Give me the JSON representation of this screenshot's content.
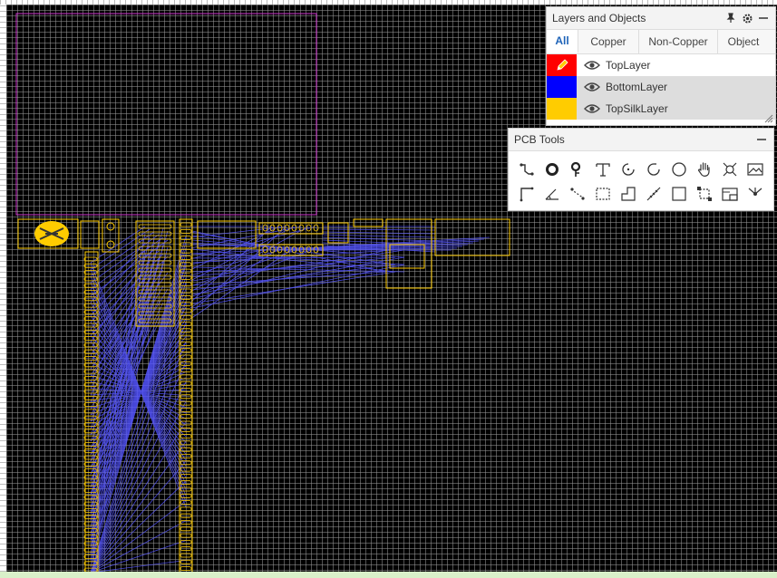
{
  "layers_panel": {
    "title": "Layers and Objects",
    "tabs": [
      {
        "label": "All",
        "active": true
      },
      {
        "label": "Copper",
        "active": false
      },
      {
        "label": "Non-Copper",
        "active": false
      },
      {
        "label": "Object",
        "active": false
      }
    ],
    "layers": [
      {
        "name": "TopLayer",
        "color": "#ff0000",
        "active": true
      },
      {
        "name": "BottomLayer",
        "color": "#0000ff",
        "active": false
      },
      {
        "name": "TopSilkLayer",
        "color": "#ffcc00",
        "active": false
      }
    ]
  },
  "tools_panel": {
    "title": "PCB Tools",
    "tools": [
      "track-icon",
      "pad-icon",
      "via-icon",
      "text-icon",
      "arc-icon",
      "center-arc-icon",
      "circle-icon",
      "pan-hand-icon",
      "connect-pad-icon",
      "image-icon",
      "dimension-icon",
      "protractor-icon",
      "jumper-icon",
      "copper-area-icon",
      "solid-region-icon",
      "measure-icon",
      "rectangle-icon",
      "hole-icon",
      "pad-group-icon",
      "fan-icon"
    ]
  },
  "colors": {
    "board_outline": "#cc33cc",
    "silkscreen": "#ffcc00",
    "ratline": "#5555ff",
    "background": "#000000"
  }
}
